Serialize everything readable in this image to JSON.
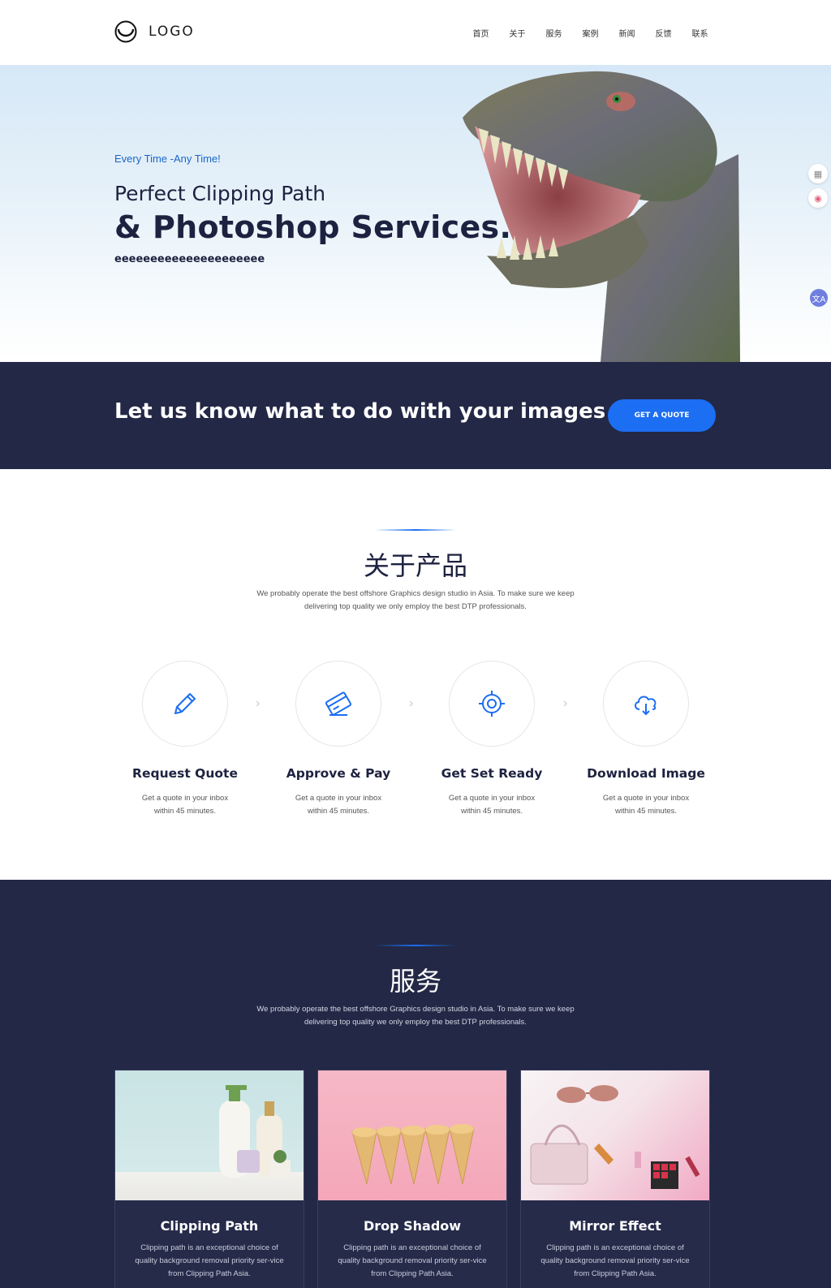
{
  "header": {
    "logo_text": "LOGO",
    "nav": [
      "首页",
      "关于",
      "服务",
      "案例",
      "新闻",
      "反馈",
      "联系"
    ]
  },
  "hero": {
    "tagline": "Every Time -Any Time!",
    "line1": "Perfect Clipping Path",
    "line2": "& Photoshop Services...",
    "line3": "eeeeeeeeeeeeeeeeeeeee"
  },
  "side_tools": {
    "icons": [
      "qr-code-icon",
      "translate-icon",
      "translate-badge-icon"
    ],
    "translate_label": "文A"
  },
  "cta": {
    "text": "Let us know what to do with your images",
    "button": "GET A QUOTE",
    "colors": {
      "background": "#232846",
      "button": "#1c6ef2"
    }
  },
  "products": {
    "title": "关于产品",
    "description": "We probably operate the best offshore Graphics design studio in Asia. To make sure we keep delivering top quality we only employ the best DTP professionals.",
    "steps": [
      {
        "icon": "pencil-icon",
        "title": "Request Quote",
        "desc": "Get a quote in your inbox within 45 minutes."
      },
      {
        "icon": "credit-card-icon",
        "title": "Approve & Pay",
        "desc": "Get a quote in your inbox within 45 minutes."
      },
      {
        "icon": "target-icon",
        "title": "Get Set Ready",
        "desc": "Get a quote in your inbox within 45 minutes."
      },
      {
        "icon": "cloud-download-icon",
        "title": "Download Image",
        "desc": "Get a quote in your inbox within 45 minutes."
      }
    ]
  },
  "services": {
    "title": "服务",
    "description": "We probably operate the best offshore Graphics design studio in Asia. To make sure we keep delivering top quality we only employ the best DTP professionals.",
    "cards": [
      {
        "title": "Clipping Path",
        "desc": "Clipping path is an exceptional choice of quality background removal priority ser-vice from Clipping Path Asia."
      },
      {
        "title": "Drop Shadow",
        "desc": "Clipping path is an exceptional choice of quality background removal priority ser-vice from Clipping Path Asia."
      },
      {
        "title": "Mirror Effect",
        "desc": "Clipping path is an exceptional choice of quality background removal priority ser-vice from Clipping Path Asia."
      }
    ]
  }
}
